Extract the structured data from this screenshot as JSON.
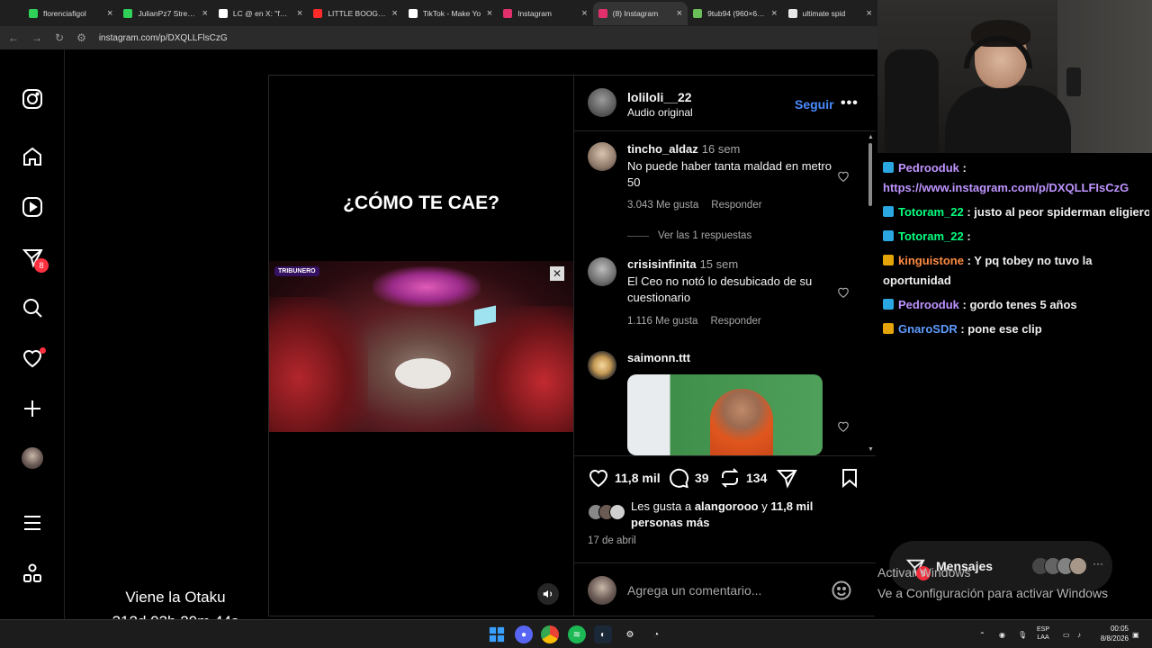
{
  "browser": {
    "tabs": [
      {
        "label": "florenciafigol",
        "color": "#30d158",
        "active": false
      },
      {
        "label": "JulianPz7 Stream",
        "color": "#30d158",
        "active": false
      },
      {
        "label": "LC @ en X: \"felici",
        "color": "#ffffff",
        "active": false
      },
      {
        "label": "LITTLE BOOGIE -",
        "color": "#ff2b2b",
        "active": false
      },
      {
        "label": "TikTok - Make Yo",
        "color": "#ffffff",
        "active": false
      },
      {
        "label": "Instagram",
        "color": "#e1306c",
        "active": false
      },
      {
        "label": "(8) Instagram",
        "color": "#e1306c",
        "active": true
      },
      {
        "label": "9tub94 (960×638)",
        "color": "#6bbf59",
        "active": false
      },
      {
        "label": "ultimate spid",
        "color": "#e8e8e8",
        "active": false
      }
    ],
    "url": "instagram.com/p/DXQLLFlsCzG"
  },
  "sidebar": {
    "notification_count": "8"
  },
  "overlay": {
    "title": "Viene la Otaku",
    "countdown": "312d 03h 20m 44s"
  },
  "video": {
    "caption": "¿CÓMO TE CAE?",
    "logo": "TRIBUNERO"
  },
  "post": {
    "username": "loliloli__22",
    "audio": "Audio original",
    "follow_label": "Seguir",
    "more_label": "•••",
    "likes_count": "11,8 mil",
    "comments_count": "39",
    "reposts_count": "134",
    "liked_by_prefix": "Les gusta a ",
    "liked_by_user": "alangorooo",
    "liked_by_suffix": " y ",
    "liked_by_rest": "11,8 mil personas más",
    "date": "17 de abril",
    "add_comment_placeholder": "Agrega un comentario..."
  },
  "comments": [
    {
      "user": "tincho_aldaz",
      "time": "16 sem",
      "text": "No puede haber tanta maldad en metro 50",
      "likes": "3.043 Me gusta",
      "reply": "Responder",
      "replies": "Ver las 1 respuestas"
    },
    {
      "user": "crisisinfinita",
      "time": "15 sem",
      "text": "El Ceo no notó lo desubicado de su cuestionario",
      "likes": "1.116 Me gusta",
      "reply": "Responder"
    },
    {
      "user": "saimonn.ttt",
      "time": "",
      "text": ""
    }
  ],
  "chat": {
    "messages": [
      {
        "user": "Pedrooduk",
        "sep": " :",
        "text": "",
        "user_color": "#bf94ff"
      },
      {
        "user": "",
        "sep": "",
        "text": "https://www.instagram.com/p/DXQLLFIsCzG",
        "user_color": "#bf94ff"
      },
      {
        "user": "Totoram_22",
        "sep": " :",
        "text": " justo al peor spiderman eligiero",
        "user_color": "#00ff7f"
      },
      {
        "user": "Totoram_22",
        "sep": " :",
        "text": "",
        "user_color": "#00ff7f"
      },
      {
        "user": "kinguistone",
        "sep": " :",
        "text": " Y pq tobey no tuvo la oportunidad",
        "user_color": "#ff8c42"
      },
      {
        "user": "Pedrooduk",
        "sep": " :",
        "text": " gordo tenes 5 años",
        "user_color": "#bf94ff"
      },
      {
        "user": "GnaroSDR",
        "sep": " :",
        "text": " pone ese clip",
        "user_color": "#5e9bff"
      }
    ]
  },
  "windows": {
    "activate_line1": "Activar Windows",
    "activate_line2": "Ve a Configuración para activar Windows"
  },
  "messages_pill": {
    "label": "Mensajes",
    "count": "8",
    "more": "···"
  },
  "taskbar": {
    "lang_top": "ESP",
    "lang_bottom": "LAA",
    "time": "00:05",
    "date": "8/8/2026",
    "colors": {
      "accent": "#0a84ff"
    }
  }
}
